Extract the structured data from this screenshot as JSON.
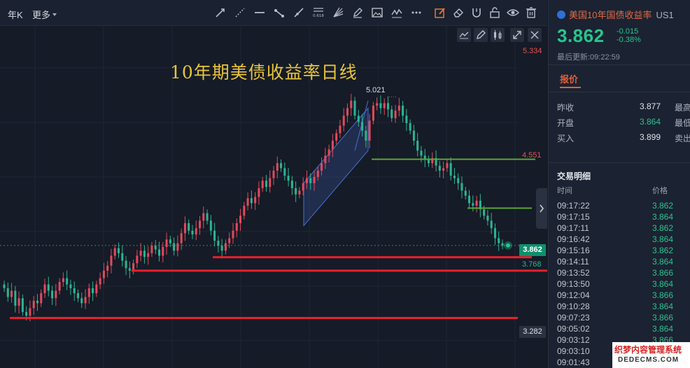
{
  "toolbar": {
    "period_label": "年K",
    "more_label": "更多",
    "tools": [
      "line-tool-icon",
      "ray-tool-icon",
      "horizontal-line-icon",
      "segment-icon",
      "extended-line-icon",
      "fibonacci-icon",
      "fan-icon",
      "pen-icon",
      "image-icon",
      "wave-icon",
      "more-dots-icon",
      "edit-icon",
      "eraser-icon",
      "magnet-icon",
      "lock-icon",
      "eye-icon",
      "trash-icon"
    ],
    "fib_label": "0.618"
  },
  "chart": {
    "title": "10年期美债收益率日线",
    "top_price": "5.334",
    "peak_label": "5.021",
    "mid_label": "4.551",
    "current_price": "3.862",
    "support_label": "3.768",
    "low_label": "3.282",
    "colors": {
      "up": "#e34a5c",
      "down": "#2bb592",
      "support": "#e8202a",
      "resistance": "#5aa638",
      "channel": "#4a6fd0"
    }
  },
  "chart_data": {
    "type": "candlestick",
    "title": "10年期美债收益率日线",
    "ylim": [
      3.1,
      5.45
    ],
    "price_labels": [
      5.334,
      5.021,
      4.551,
      3.862,
      3.768,
      3.282
    ],
    "series": [
      {
        "name": "",
        "closes": [
          3.52,
          3.45,
          3.5,
          3.38,
          3.44,
          3.33,
          3.3,
          3.36,
          3.42,
          3.4,
          3.48,
          3.55,
          3.5,
          3.44,
          3.5,
          3.57,
          3.6,
          3.55,
          3.52,
          3.48,
          3.44,
          3.4,
          3.45,
          3.52,
          3.48,
          3.55,
          3.6,
          3.66,
          3.7,
          3.78,
          3.84,
          3.8,
          3.74,
          3.68,
          3.66,
          3.72,
          3.78,
          3.82,
          3.77,
          3.8,
          3.86,
          3.83,
          3.78,
          3.85,
          3.91,
          3.88,
          3.82,
          3.88,
          3.96,
          4.04,
          3.98,
          3.95,
          4.0,
          4.06,
          4.12,
          4.06,
          3.98,
          3.9,
          3.86,
          3.82,
          3.88,
          3.92,
          3.98,
          4.04,
          4.1,
          4.18,
          4.24,
          4.2,
          4.25,
          4.32,
          4.38,
          4.33,
          4.4,
          4.46,
          4.52,
          4.48,
          4.42,
          4.38,
          4.32,
          4.27,
          4.3,
          4.36,
          4.4,
          4.36,
          4.41,
          4.46,
          4.52,
          4.58,
          4.63,
          4.7,
          4.76,
          4.82,
          4.9,
          4.96,
          5.02,
          4.9,
          4.85,
          4.78,
          4.7,
          4.86,
          4.98,
          5.0,
          4.96,
          5.0,
          4.95,
          4.88,
          4.94,
          4.98,
          4.9,
          4.84,
          4.78,
          4.7,
          4.62,
          4.58,
          4.55,
          4.52,
          4.56,
          4.5,
          4.46,
          4.48,
          4.52,
          4.42,
          4.4,
          4.36,
          4.3,
          4.26,
          4.2,
          4.18,
          4.22,
          4.15,
          4.1,
          4.06,
          4.0,
          3.92,
          3.88,
          3.86
        ]
      }
    ],
    "lines": [
      {
        "type": "horizontal",
        "value": 4.551,
        "color": "green"
      },
      {
        "type": "horizontal",
        "value": 4.16,
        "color": "green"
      },
      {
        "type": "horizontal",
        "value": 3.768,
        "color": "red"
      },
      {
        "type": "horizontal",
        "value": 3.66,
        "color": "red"
      },
      {
        "type": "horizontal",
        "value": 3.282,
        "color": "red"
      }
    ]
  },
  "panel": {
    "instrument": "美国10年国债收益率",
    "symbol": "US1",
    "price": "3.862",
    "change": "-0.015",
    "change_pct": "-0.38%",
    "update_time": "最后更新:09:22:59",
    "tab_label": "报价",
    "quotes": [
      {
        "label": "昨收",
        "value": "3.877",
        "extra": "最高",
        "green": false
      },
      {
        "label": "开盘",
        "value": "3.864",
        "extra": "最低",
        "green": true
      },
      {
        "label": "买入",
        "value": "3.899",
        "extra": "卖出",
        "green": false
      }
    ],
    "trades_title": "交易明细",
    "trades_header": {
      "time": "时间",
      "price": "价格"
    },
    "trades": [
      {
        "time": "09:17:22",
        "price": "3.862"
      },
      {
        "time": "09:17:15",
        "price": "3.864"
      },
      {
        "time": "09:17:11",
        "price": "3.862"
      },
      {
        "time": "09:16:42",
        "price": "3.864"
      },
      {
        "time": "09:15:16",
        "price": "3.862"
      },
      {
        "time": "09:14:11",
        "price": "3.864"
      },
      {
        "time": "09:13:52",
        "price": "3.866"
      },
      {
        "time": "09:13:50",
        "price": "3.864"
      },
      {
        "time": "09:12:04",
        "price": "3.866"
      },
      {
        "time": "09:10:28",
        "price": "3.864"
      },
      {
        "time": "09:07:23",
        "price": "3.866"
      },
      {
        "time": "09:05:02",
        "price": "3.864"
      },
      {
        "time": "09:03:12",
        "price": "3.866"
      },
      {
        "time": "09:03:10",
        "price": "3.864"
      },
      {
        "time": "09:01:43",
        "price": "3.866"
      }
    ]
  },
  "watermark": {
    "line1": "织梦内容管理系统",
    "line2": "DEDECMS.COM"
  }
}
